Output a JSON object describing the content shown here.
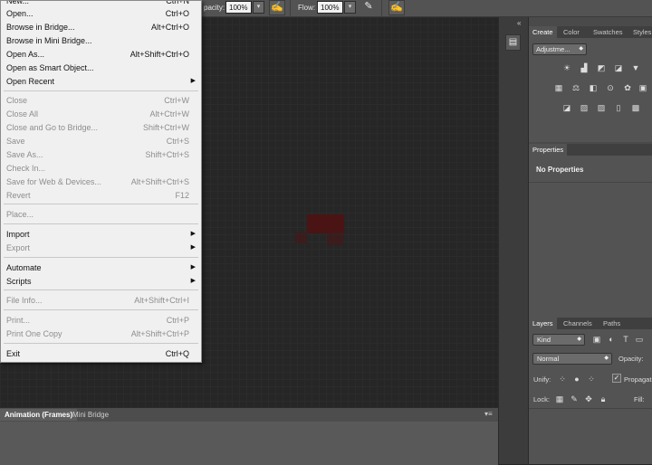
{
  "options_bar": {
    "opacity_label": "pacity:",
    "opacity_value": "100%",
    "flow_label": "Flow:",
    "flow_value": "100%"
  },
  "file_menu": {
    "items": [
      {
        "label": "New...",
        "shortcut": "Ctrl+N",
        "disabled": false
      },
      {
        "label": "Open...",
        "shortcut": "Ctrl+O",
        "disabled": false
      },
      {
        "label": "Browse in Bridge...",
        "shortcut": "Alt+Ctrl+O",
        "disabled": false
      },
      {
        "label": "Browse in Mini Bridge...",
        "shortcut": "",
        "disabled": false
      },
      {
        "label": "Open As...",
        "shortcut": "Alt+Shift+Ctrl+O",
        "disabled": false
      },
      {
        "label": "Open as Smart Object...",
        "shortcut": "",
        "disabled": false
      },
      {
        "label": "Open Recent",
        "shortcut": "",
        "submenu": true
      },
      {
        "label": "Close",
        "shortcut": "Ctrl+W",
        "disabled": true
      },
      {
        "label": "Close All",
        "shortcut": "Alt+Ctrl+W",
        "disabled": true
      },
      {
        "label": "Close and Go to Bridge...",
        "shortcut": "Shift+Ctrl+W",
        "disabled": true
      },
      {
        "label": "Save",
        "shortcut": "Ctrl+S",
        "disabled": true
      },
      {
        "label": "Save As...",
        "shortcut": "Shift+Ctrl+S",
        "disabled": true
      },
      {
        "label": "Check In...",
        "shortcut": "",
        "disabled": true
      },
      {
        "label": "Save for Web & Devices...",
        "shortcut": "Alt+Shift+Ctrl+S",
        "disabled": true
      },
      {
        "label": "Revert",
        "shortcut": "F12",
        "disabled": true
      },
      {
        "label": "Place...",
        "shortcut": "",
        "disabled": true
      },
      {
        "label": "Import",
        "shortcut": "",
        "submenu": true
      },
      {
        "label": "Export",
        "shortcut": "",
        "submenu": true,
        "disabled": true
      },
      {
        "label": "Automate",
        "shortcut": "",
        "submenu": true
      },
      {
        "label": "Scripts",
        "shortcut": "",
        "submenu": true
      },
      {
        "label": "File Info...",
        "shortcut": "Alt+Shift+Ctrl+I",
        "disabled": true
      },
      {
        "label": "Print...",
        "shortcut": "Ctrl+P",
        "disabled": true
      },
      {
        "label": "Print One Copy",
        "shortcut": "Alt+Shift+Ctrl+P",
        "disabled": true
      },
      {
        "label": "Exit",
        "shortcut": "Ctrl+Q",
        "disabled": false
      }
    ]
  },
  "bottom_panel": {
    "tabs": [
      "Animation (Frames)",
      "Mini Bridge"
    ]
  },
  "adjustments_panel": {
    "tabs": [
      "Create",
      "Color",
      "Swatches",
      "Styles"
    ],
    "dropdown": "Adjustme..."
  },
  "properties_panel": {
    "tab": "Properties",
    "message": "No Properties"
  },
  "layers_panel": {
    "tabs": [
      "Layers",
      "Channels",
      "Paths"
    ],
    "kind": "Kind",
    "blend_mode": "Normal",
    "opacity_label": "Opacity:",
    "unify_label": "Unify:",
    "propagate_label": "Propagat",
    "lock_label": "Lock:",
    "fill_label": "Fill:"
  }
}
